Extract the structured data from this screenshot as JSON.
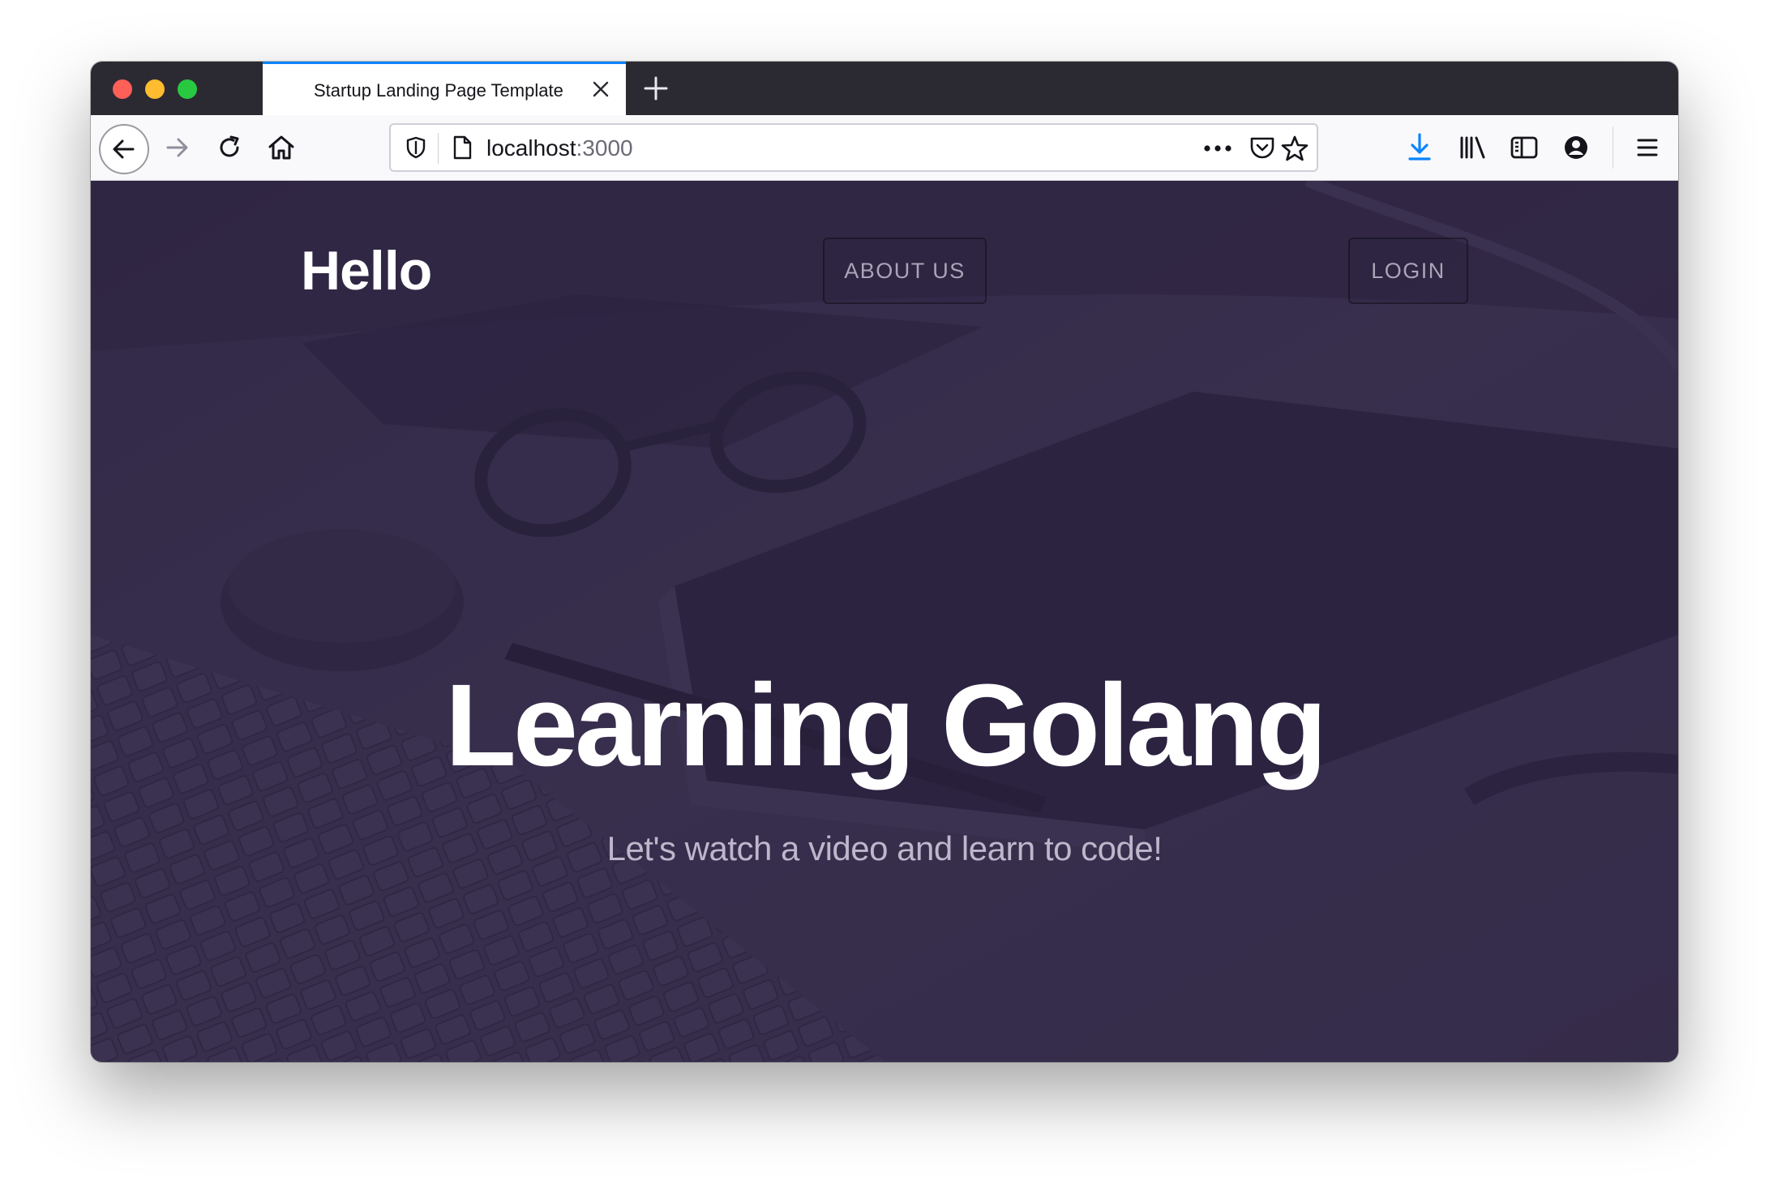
{
  "browser": {
    "tab_title": "Startup Landing Page Template",
    "url_host": "localhost",
    "url_port": ":3000",
    "accent_color": "#0a84ff"
  },
  "toolbar_icons": [
    "back-icon",
    "forward-icon",
    "reload-icon",
    "home-icon",
    "shield-icon",
    "page-icon",
    "more-icon",
    "pocket-icon",
    "star-icon",
    "download-icon",
    "library-icon",
    "sidebar-icon",
    "account-icon",
    "menu-icon"
  ],
  "page": {
    "brand": "Hello",
    "nav": {
      "about_label": "ABOUT US",
      "login_label": "LOGIN"
    },
    "hero": {
      "title": "Learning Golang",
      "subtitle": "Let's watch a video and learn to code!"
    },
    "colors": {
      "overlay": "#2d2442",
      "background": "#3a3150"
    }
  }
}
